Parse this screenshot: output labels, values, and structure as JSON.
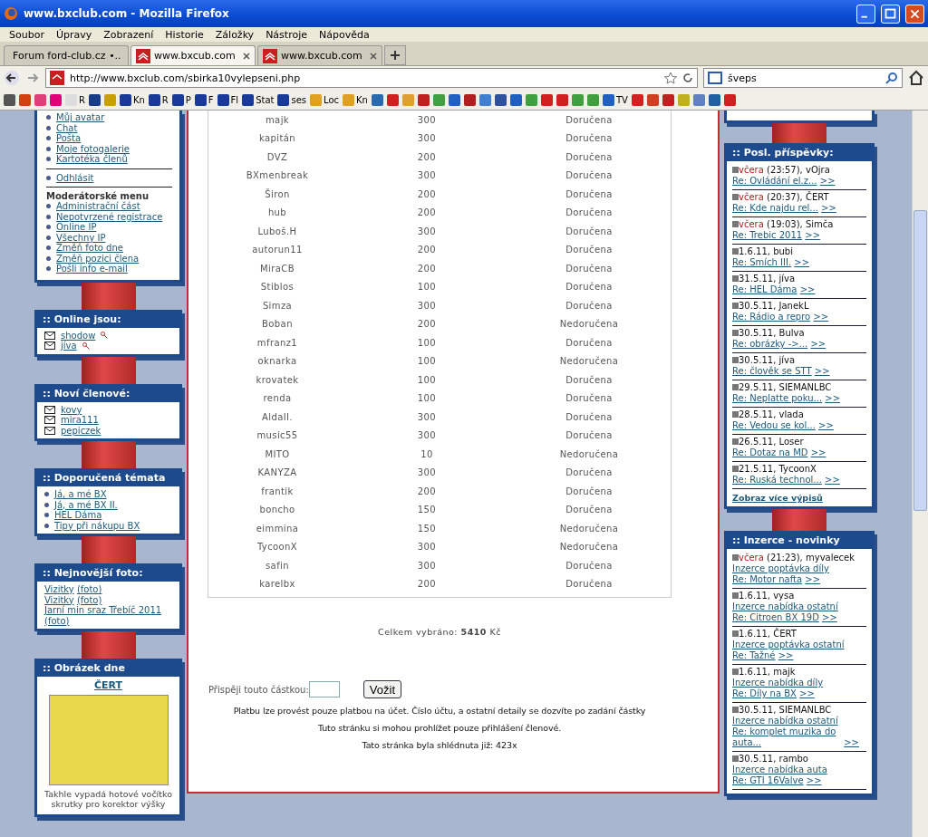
{
  "window": {
    "title": "www.bxclub.com - Mozilla Firefox"
  },
  "menu": [
    "Soubor",
    "Úpravy",
    "Zobrazení",
    "Historie",
    "Záložky",
    "Nástroje",
    "Nápověda"
  ],
  "tabs": [
    {
      "label": "Forum ford-club.cz •..",
      "selected": false,
      "kind": "ford"
    },
    {
      "label": "www.bxcub.com",
      "selected": true,
      "kind": "club"
    },
    {
      "label": "www.bxcub.com",
      "selected": false,
      "kind": "club"
    }
  ],
  "address": {
    "url": "http://www.bxclub.com/sbirka10vylepseni.php"
  },
  "search": {
    "value": "šveps"
  },
  "bookmarks": [
    {
      "kind": "icon",
      "color": "#555555"
    },
    {
      "kind": "icon",
      "color": "#d04010"
    },
    {
      "kind": "icon",
      "color": "#e0407a"
    },
    {
      "kind": "icon",
      "color": "#e2007a"
    },
    {
      "kind": "labeled",
      "label": "R",
      "color": "#dddddd"
    },
    {
      "kind": "icon",
      "color": "#1a3a8a"
    },
    {
      "kind": "icon",
      "color": "#caa000"
    },
    {
      "kind": "labeled",
      "label": "Kn",
      "color": "#1a3a9a"
    },
    {
      "kind": "labeled",
      "label": "R",
      "color": "#1a3a9a"
    },
    {
      "kind": "labeled",
      "label": "P",
      "color": "#1a3a9a"
    },
    {
      "kind": "labeled",
      "label": "F",
      "color": "#1a3a9a"
    },
    {
      "kind": "labeled",
      "label": "Fl",
      "color": "#1a3a9a"
    },
    {
      "kind": "labeled",
      "label": "Stat",
      "color": "#1a3a9a"
    },
    {
      "kind": "labeled",
      "label": "ses",
      "color": "#1a3a9a"
    },
    {
      "kind": "labeled",
      "label": "Loc",
      "color": "#e0a020"
    },
    {
      "kind": "labeled",
      "label": "Kn",
      "color": "#e0a020"
    },
    {
      "kind": "icon",
      "color": "#2a6ab0"
    },
    {
      "kind": "icon",
      "color": "#d02020"
    },
    {
      "kind": "icon",
      "color": "#e0a030"
    },
    {
      "kind": "icon",
      "color": "#c02020"
    },
    {
      "kind": "icon",
      "color": "#40a040"
    },
    {
      "kind": "icon",
      "color": "#2060c0"
    },
    {
      "kind": "icon",
      "color": "#b02020"
    },
    {
      "kind": "icon",
      "color": "#4080d0"
    },
    {
      "kind": "icon",
      "color": "#3050a0"
    },
    {
      "kind": "icon",
      "color": "#2060c0"
    },
    {
      "kind": "icon",
      "color": "#40a040"
    },
    {
      "kind": "icon",
      "color": "#d02020"
    },
    {
      "kind": "icon",
      "color": "#d02020"
    },
    {
      "kind": "icon",
      "color": "#40a040"
    },
    {
      "kind": "icon",
      "color": "#40a040"
    },
    {
      "kind": "labeled",
      "label": "TV",
      "color": "#2060c0"
    },
    {
      "kind": "icon",
      "color": "#d02020"
    },
    {
      "kind": "icon",
      "color": "#d04020"
    },
    {
      "kind": "icon",
      "color": "#c02020"
    },
    {
      "kind": "icon",
      "color": "#c0b020"
    },
    {
      "kind": "icon",
      "color": "#6080c0"
    },
    {
      "kind": "icon",
      "color": "#2060a0"
    },
    {
      "kind": "icon",
      "color": "#d02020"
    }
  ],
  "left": {
    "user_menu": [
      "Můj avatar",
      "Chat",
      "Pošta",
      "Moje fotogalerie",
      "Kartotéka členů"
    ],
    "logout": "Odhlásit",
    "moderator_title": "Moderátorské menu",
    "moderator_menu": [
      "Administrační část",
      "Nepotvrzené registrace",
      "Online IP",
      "Všechny IP",
      "Změň foto dne",
      "Změň pozici člena",
      "Pošli info e-mail"
    ],
    "online": {
      "title": ":: Online jsou:",
      "users": [
        "shodow",
        "jíva"
      ]
    },
    "new_members": {
      "title": ":: Noví členové:",
      "users": [
        "kovy",
        "mira111",
        "pepiczek"
      ]
    },
    "topics": {
      "title": ":: Doporučená témata",
      "items": [
        "Já, a mé BX",
        "Já, a mé BX    II.",
        "HEL Dáma",
        "Tipy při nákupu BX"
      ]
    },
    "photos": {
      "title": ":: Nejnovější foto:",
      "items": [
        {
          "name": "Vizitky",
          "link": "(foto)"
        },
        {
          "name": "Vizitky",
          "link": "(foto)"
        },
        {
          "name": "Jarní min sraz Třebíč 2011",
          "link": "(foto)"
        }
      ]
    },
    "picture": {
      "title": ":: Obrázek dne",
      "author": "ČERT",
      "caption": "Takhle vypadá hotové vočítko skrutky pro korektor výšky"
    }
  },
  "table": {
    "rows": [
      {
        "name": "majk",
        "amount": "300",
        "status": "Doručena"
      },
      {
        "name": "kapitán",
        "amount": "300",
        "status": "Doručena"
      },
      {
        "name": "DVZ",
        "amount": "200",
        "status": "Doručena"
      },
      {
        "name": "BXmenbreak",
        "amount": "300",
        "status": "Doručena"
      },
      {
        "name": "Širon",
        "amount": "200",
        "status": "Doručena"
      },
      {
        "name": "hub",
        "amount": "200",
        "status": "Doručena"
      },
      {
        "name": "Luboš.H",
        "amount": "300",
        "status": "Doručena"
      },
      {
        "name": "autorun11",
        "amount": "200",
        "status": "Doručena"
      },
      {
        "name": "MiraCB",
        "amount": "200",
        "status": "Doručena"
      },
      {
        "name": "Stiblos",
        "amount": "100",
        "status": "Doručena"
      },
      {
        "name": "Simza",
        "amount": "300",
        "status": "Doručena"
      },
      {
        "name": "Boban",
        "amount": "200",
        "status": "Nedoručena"
      },
      {
        "name": "mfranz1",
        "amount": "100",
        "status": "Doručena"
      },
      {
        "name": "oknarka",
        "amount": "100",
        "status": "Nedoručena"
      },
      {
        "name": "krovatek",
        "amount": "100",
        "status": "Doručena"
      },
      {
        "name": "renda",
        "amount": "100",
        "status": "Doručena"
      },
      {
        "name": "AldaII.",
        "amount": "300",
        "status": "Doručena"
      },
      {
        "name": "music55",
        "amount": "300",
        "status": "Doručena"
      },
      {
        "name": "MITO",
        "amount": "10",
        "status": "Nedoručena"
      },
      {
        "name": "KANYZA",
        "amount": "300",
        "status": "Doručena"
      },
      {
        "name": "frantik",
        "amount": "200",
        "status": "Doručena"
      },
      {
        "name": "boncho",
        "amount": "150",
        "status": "Doručena"
      },
      {
        "name": "eimmina",
        "amount": "150",
        "status": "Nedoručena"
      },
      {
        "name": "TycoonX",
        "amount": "300",
        "status": "Nedoručena"
      },
      {
        "name": "safin",
        "amount": "300",
        "status": "Doručena"
      },
      {
        "name": "karelbx",
        "amount": "200",
        "status": "Doručena"
      }
    ]
  },
  "total": "Celkem vybráno: **5410** Kč",
  "contribute": {
    "label": "Přispěji touto částkou:",
    "button": "Vožit"
  },
  "notes": [
    "Platbu lze provést pouze platbou na účet. Číslo účtu, a ostatní detaily se dozvíte po zadání částky",
    "Tuto stránku si mohou prohlížet pouze přihlášení členové.",
    "Tato stránka byla shlédnuta již: 423x"
  ],
  "posts": {
    "title": ":: Posl. příspěvky:",
    "items": [
      {
        "day": "včera",
        "recent": true,
        "rest": " (23:57), vOjra",
        "link": "Re: Ovládání el.z...",
        "more": ">>"
      },
      {
        "day": "včera",
        "recent": true,
        "rest": " (20:37), ČERT",
        "link": "Re: Kde najdu rel...",
        "more": ">>"
      },
      {
        "day": "včera",
        "recent": true,
        "rest": " (19:03), Simča",
        "link": "Re: Trebic 2011",
        "more": ">>"
      },
      {
        "day": "1.6.11",
        "recent": false,
        "rest": ", bubi",
        "link": "Re: Smích III.",
        "more": ">>"
      },
      {
        "day": "31.5.11",
        "recent": false,
        "rest": ", jíva",
        "link": "Re: HEL Dáma",
        "more": ">>"
      },
      {
        "day": "30.5.11",
        "recent": false,
        "rest": ", JanekL",
        "link": "Re: Rádio a repro",
        "more": ">>"
      },
      {
        "day": "30.5.11",
        "recent": false,
        "rest": ", Bulva",
        "link": "Re: obrázky ->...",
        "more": ">>"
      },
      {
        "day": "30.5.11",
        "recent": false,
        "rest": ", jíva",
        "link": "Re: člověk se STT",
        "more": ">>"
      },
      {
        "day": "29.5.11",
        "recent": false,
        "rest": ", SIEMANLBC",
        "link": "Re: Neplatte poku...",
        "more": ">>"
      },
      {
        "day": "28.5.11",
        "recent": false,
        "rest": ", vlada",
        "link": "Re: Vedou se kol...",
        "more": ">>"
      },
      {
        "day": "26.5.11",
        "recent": false,
        "rest": ", Loser",
        "link": "Re: Dotaz na MD",
        "more": ">>"
      },
      {
        "day": "21.5.11",
        "recent": false,
        "rest": ", TycoonX",
        "link": "Re: Ruská technol...",
        "more": ">>"
      }
    ],
    "more_link": "Zobraz více výpisů"
  },
  "ads": {
    "title": ":: Inzerce - novinky",
    "items": [
      {
        "day": "včera",
        "recent": true,
        "rest": " (21:23), myvalecek",
        "category": "Inzerce poptávka díly",
        "link": "Re: Motor nafta",
        "more": ">>"
      },
      {
        "day": "1.6.11",
        "recent": false,
        "rest": ", vysa",
        "category": "Inzerce nabídka ostatní",
        "link": "Re: Citroen BX 19D",
        "more": ">>"
      },
      {
        "day": "1.6.11",
        "recent": false,
        "rest": ", ČERT",
        "category": "Inzerce poptávka ostatní",
        "link": "Re: Tažné",
        "more": ">>"
      },
      {
        "day": "1.6.11",
        "recent": false,
        "rest": ", majk",
        "category": "Inzerce nabídka díly",
        "link": "Re: Díly na BX",
        "more": ">>"
      },
      {
        "day": "30.5.11",
        "recent": false,
        "rest": ", SIEMANLBC",
        "category": "Inzerce nabídka ostatní",
        "link": "Re: komplet muzika do auta...",
        "more": ">>"
      },
      {
        "day": "30.5.11",
        "recent": false,
        "rest": ", rambo",
        "category": "Inzerce nabídka auta",
        "link": "Re: GTI 16Valve",
        "more": ">>"
      }
    ]
  }
}
